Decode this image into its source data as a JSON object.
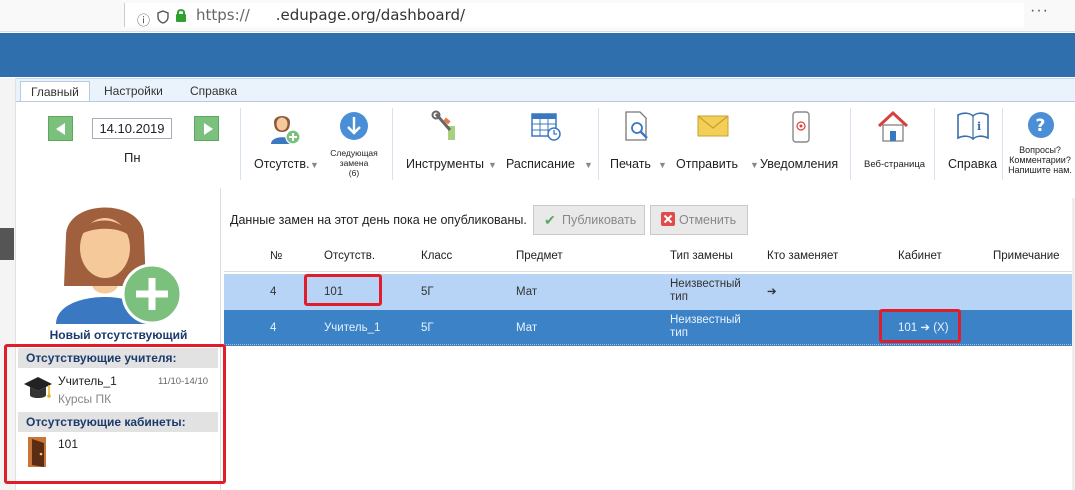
{
  "browser": {
    "url_prefix": "https://",
    "url_domain": ".edupage.org/dashboard/"
  },
  "ribbon": {
    "tabs": [
      {
        "label": "Главный",
        "active": true
      },
      {
        "label": "Настройки",
        "active": false
      },
      {
        "label": "Справка",
        "active": false
      }
    ],
    "date_value": "14.10.2019",
    "day_label": "Пн",
    "buttons": {
      "absent": "Отсутств.",
      "next_sub_line1": "Следующая",
      "next_sub_line2": "замена",
      "next_sub_count": "(6)",
      "tools": "Инструменты",
      "schedule": "Расписание",
      "print": "Печать",
      "send": "Отправить",
      "notify": "Уведомления",
      "webpage": "Веб-страница",
      "help": "Справка",
      "questions_line1": "Вопросы?",
      "questions_line2": "Комментарии?",
      "questions_line3": "Напишите нам."
    }
  },
  "left_panel": {
    "new_absent_label": "Новый отсутствующий",
    "absent_teachers_title": "Отсутствующие учителя:",
    "teacher": {
      "name": "Учитель_1",
      "dates": "11/10-14/10",
      "reason": "Курсы ПК"
    },
    "absent_rooms_title": "Отсутствующие кабинеты:",
    "room": {
      "name": "101"
    }
  },
  "main": {
    "notice": "Данные замен на этот день пока не опубликованы.",
    "publish_button": "Публиковать",
    "cancel_button": "Отменить",
    "columns": [
      "№",
      "Отсутств.",
      "Класс",
      "Предмет",
      "Тип замены",
      "Кто заменяет",
      "Кабинет",
      "Примечание"
    ],
    "rows": [
      {
        "num": "4",
        "absent": "101",
        "class": "5Г",
        "subject": "Мат",
        "type_line1": "Неизвестный",
        "type_line2": "тип",
        "replacer": "➔",
        "room": "",
        "note": ""
      },
      {
        "num": "4",
        "absent": "Учитель_1",
        "class": "5Г",
        "subject": "Мат",
        "type_line1": "Неизвестный",
        "type_line2": "тип",
        "replacer": "",
        "room": "101 ➔ (X)",
        "note": ""
      }
    ]
  },
  "colors": {
    "header_blue": "#2f6fad",
    "row_light": "#b7d3f6",
    "row_selected": "#3b82c6",
    "highlight_red": "#e01e2b"
  }
}
